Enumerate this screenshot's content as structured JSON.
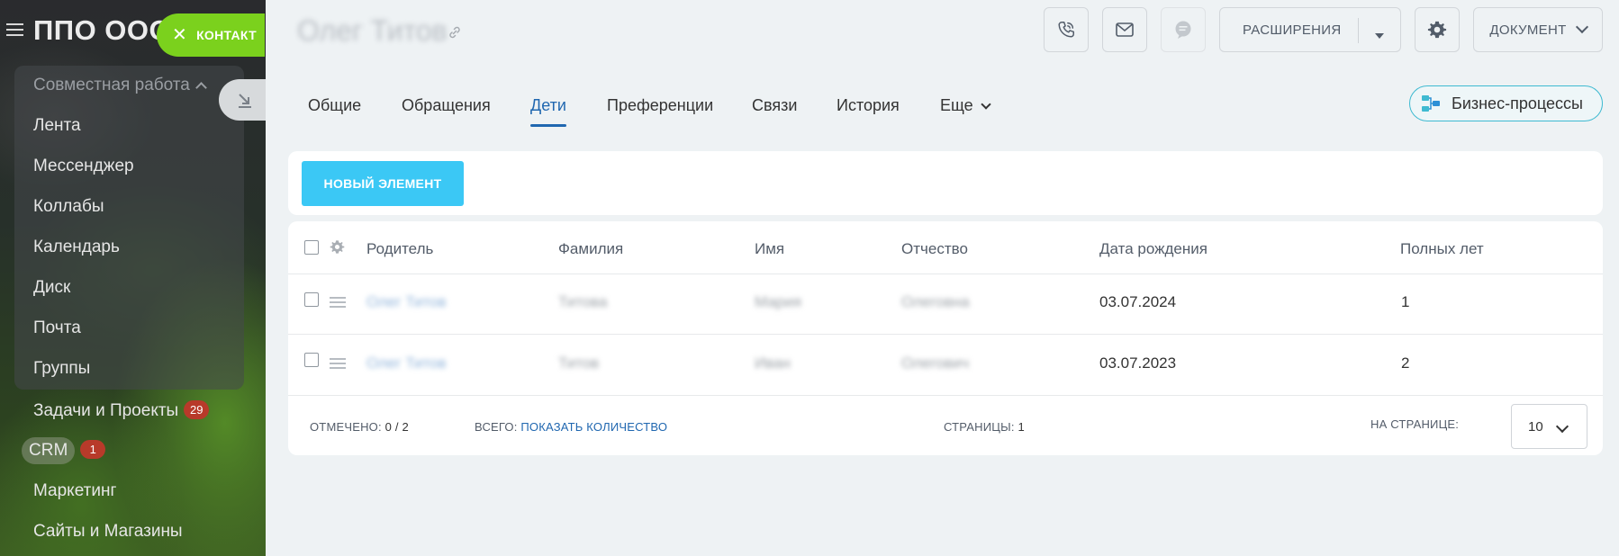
{
  "sidebar": {
    "logo": "ППО ООО",
    "group_label": "Совместная работа",
    "items": [
      {
        "label": "Лента"
      },
      {
        "label": "Мессенджер"
      },
      {
        "label": "Коллабы"
      },
      {
        "label": "Календарь"
      },
      {
        "label": "Диск"
      },
      {
        "label": "Почта"
      },
      {
        "label": "Группы"
      },
      {
        "label": "Задачи и Проекты",
        "badge": "29"
      },
      {
        "label": "CRM",
        "badge": "1"
      },
      {
        "label": "Маркетинг"
      },
      {
        "label": "Сайты и Магазины"
      }
    ],
    "contact_button": "КОНТАКТ"
  },
  "header": {
    "title": "Олег Титов",
    "extensions_label": "РАСШИРЕНИЯ",
    "document_label": "ДОКУМЕНТ"
  },
  "tabs": [
    {
      "label": "Общие"
    },
    {
      "label": "Обращения"
    },
    {
      "label": "Дети"
    },
    {
      "label": "Преференции"
    },
    {
      "label": "Связи"
    },
    {
      "label": "История"
    },
    {
      "label": "Еще"
    }
  ],
  "business_process_label": "Бизнес-процессы",
  "toolbar": {
    "new_element_label": "НОВЫЙ ЭЛЕМЕНТ"
  },
  "grid": {
    "columns": [
      "Родитель",
      "Фамилия",
      "Имя",
      "Отчество",
      "Дата рождения",
      "Полных лет"
    ],
    "rows": [
      {
        "parent": "Олег Титов",
        "surname": "Титова",
        "name": "Мария",
        "patronymic": "Олеговна",
        "birthdate": "03.07.2024",
        "age": "1"
      },
      {
        "parent": "Олег Титов",
        "surname": "Титов",
        "name": "Иван",
        "patronymic": "Олегович",
        "birthdate": "03.07.2023",
        "age": "2"
      }
    ],
    "footer": {
      "selected_label": "ОТМЕЧЕНО:",
      "selected_value": "0 / 2",
      "total_label": "ВСЕГО:",
      "total_link": "ПОКАЗАТЬ КОЛИЧЕСТВО",
      "pages_label": "СТРАНИЦЫ:",
      "pages_value": "1",
      "per_page_label": "НА СТРАНИЦЕ:",
      "per_page_value": "10"
    }
  },
  "colors": {
    "accent_blue": "#2067b0",
    "new_button": "#3bc8f5",
    "contact_button": "#7bd11d",
    "badge": "#b83a2a",
    "business_process_border": "#3fbad1"
  }
}
